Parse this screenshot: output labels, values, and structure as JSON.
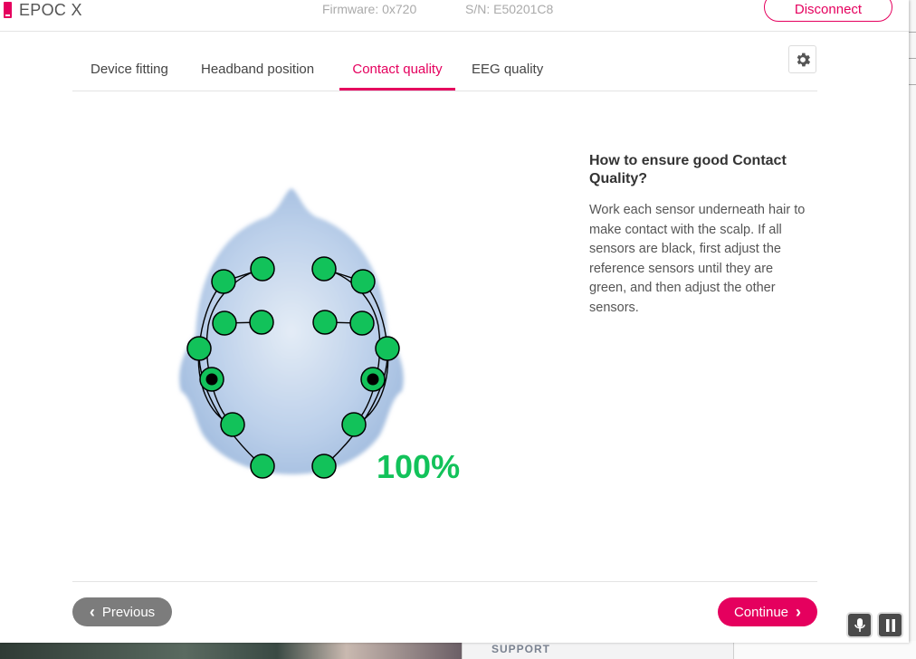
{
  "app": {
    "title": "EPOC X"
  },
  "device": {
    "firmware": "Firmware: 0x720",
    "serial": "S/N: E50201C8"
  },
  "header": {
    "disconnect_label": "Disconnect"
  },
  "tabs": [
    {
      "label": "Device fitting",
      "active": false
    },
    {
      "label": "Headband position",
      "active": false
    },
    {
      "label": "Contact quality",
      "active": true
    },
    {
      "label": "EEG quality",
      "active": false
    }
  ],
  "settings": {
    "icon": "gear-icon"
  },
  "contact_quality": {
    "percent": "100%",
    "good_color": "#12c25a",
    "sensors": [
      {
        "state": "good"
      },
      {
        "state": "good"
      },
      {
        "state": "good"
      },
      {
        "state": "good"
      },
      {
        "state": "good"
      },
      {
        "state": "good"
      },
      {
        "state": "good"
      },
      {
        "state": "good"
      },
      {
        "state": "good"
      },
      {
        "state": "good"
      },
      {
        "state": "reference"
      },
      {
        "state": "reference"
      },
      {
        "state": "good"
      },
      {
        "state": "good"
      },
      {
        "state": "good"
      },
      {
        "state": "good"
      }
    ]
  },
  "help": {
    "title": "How to ensure good Contact Quality?",
    "body": "Work each sensor underneath hair to make contact with the scalp. If all sensors are black, first adjust the reference sensors until they are green, and then adjust the other sensors."
  },
  "footer": {
    "previous_label": "Previous",
    "continue_label": "Continue"
  },
  "background": {
    "support_label": "SUPPORT"
  },
  "colors": {
    "accent": "#e5005e",
    "prev_button": "#7c7c7c"
  }
}
